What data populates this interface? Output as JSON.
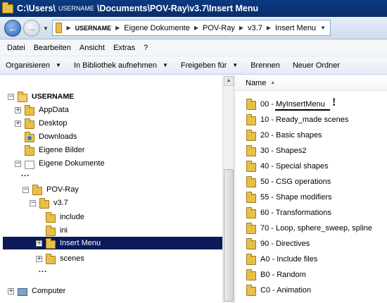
{
  "title": {
    "prefix": "C:\\Users\\",
    "user": "USERNAME",
    "suffix": "\\Documents\\POV-Ray\\v3.7\\Insert Menu"
  },
  "address": {
    "crumbs": [
      "USERNAME",
      "Eigene Dokumente",
      "POV-Ray",
      "v3.7",
      "Insert Menu"
    ]
  },
  "menu": [
    "Datei",
    "Bearbeiten",
    "Ansicht",
    "Extras",
    "?"
  ],
  "toolbar": {
    "organize": "Organisieren",
    "library": "In Bibliothek aufnehmen",
    "share": "Freigeben für",
    "burn": "Brennen",
    "new_folder": "Neuer Ordner"
  },
  "tree": {
    "username": "USERNAME",
    "appdata": "AppData",
    "desktop": "Desktop",
    "downloads": "Downloads",
    "pictures": "Eigene Bilder",
    "documents": "Eigene Dokumente",
    "dots1": "...",
    "povray": "POV-Ray",
    "v37": "v3.7",
    "include": "include",
    "ini": "ini",
    "insert_menu": "Insert Menu",
    "scenes": "scenes",
    "dots2": "...",
    "computer": "Computer"
  },
  "column": {
    "name": "Name"
  },
  "files": [
    "00 - MyInsertMenu",
    "10 - Ready_made scenes",
    "20 - Basic shapes",
    "30 - Shapes2",
    "40 - Special shapes",
    "50 - CSG operations",
    "55 - Shape modifiers",
    "60 - Transformations",
    "70 - Loop, sphere_sweep, spline",
    "90 - Directives",
    "A0 - Include files",
    "B0 - Random",
    "C0 - Animation"
  ],
  "annotation": {
    "mark": "!"
  },
  "colors": {
    "title_bg": "#0b3a82",
    "selection_bg": "#0c1a5a",
    "folder": "#e8c048"
  },
  "icons": {
    "back": "arrow-left-icon",
    "forward": "arrow-right-icon",
    "folder": "folder-icon",
    "computer": "computer-icon"
  }
}
